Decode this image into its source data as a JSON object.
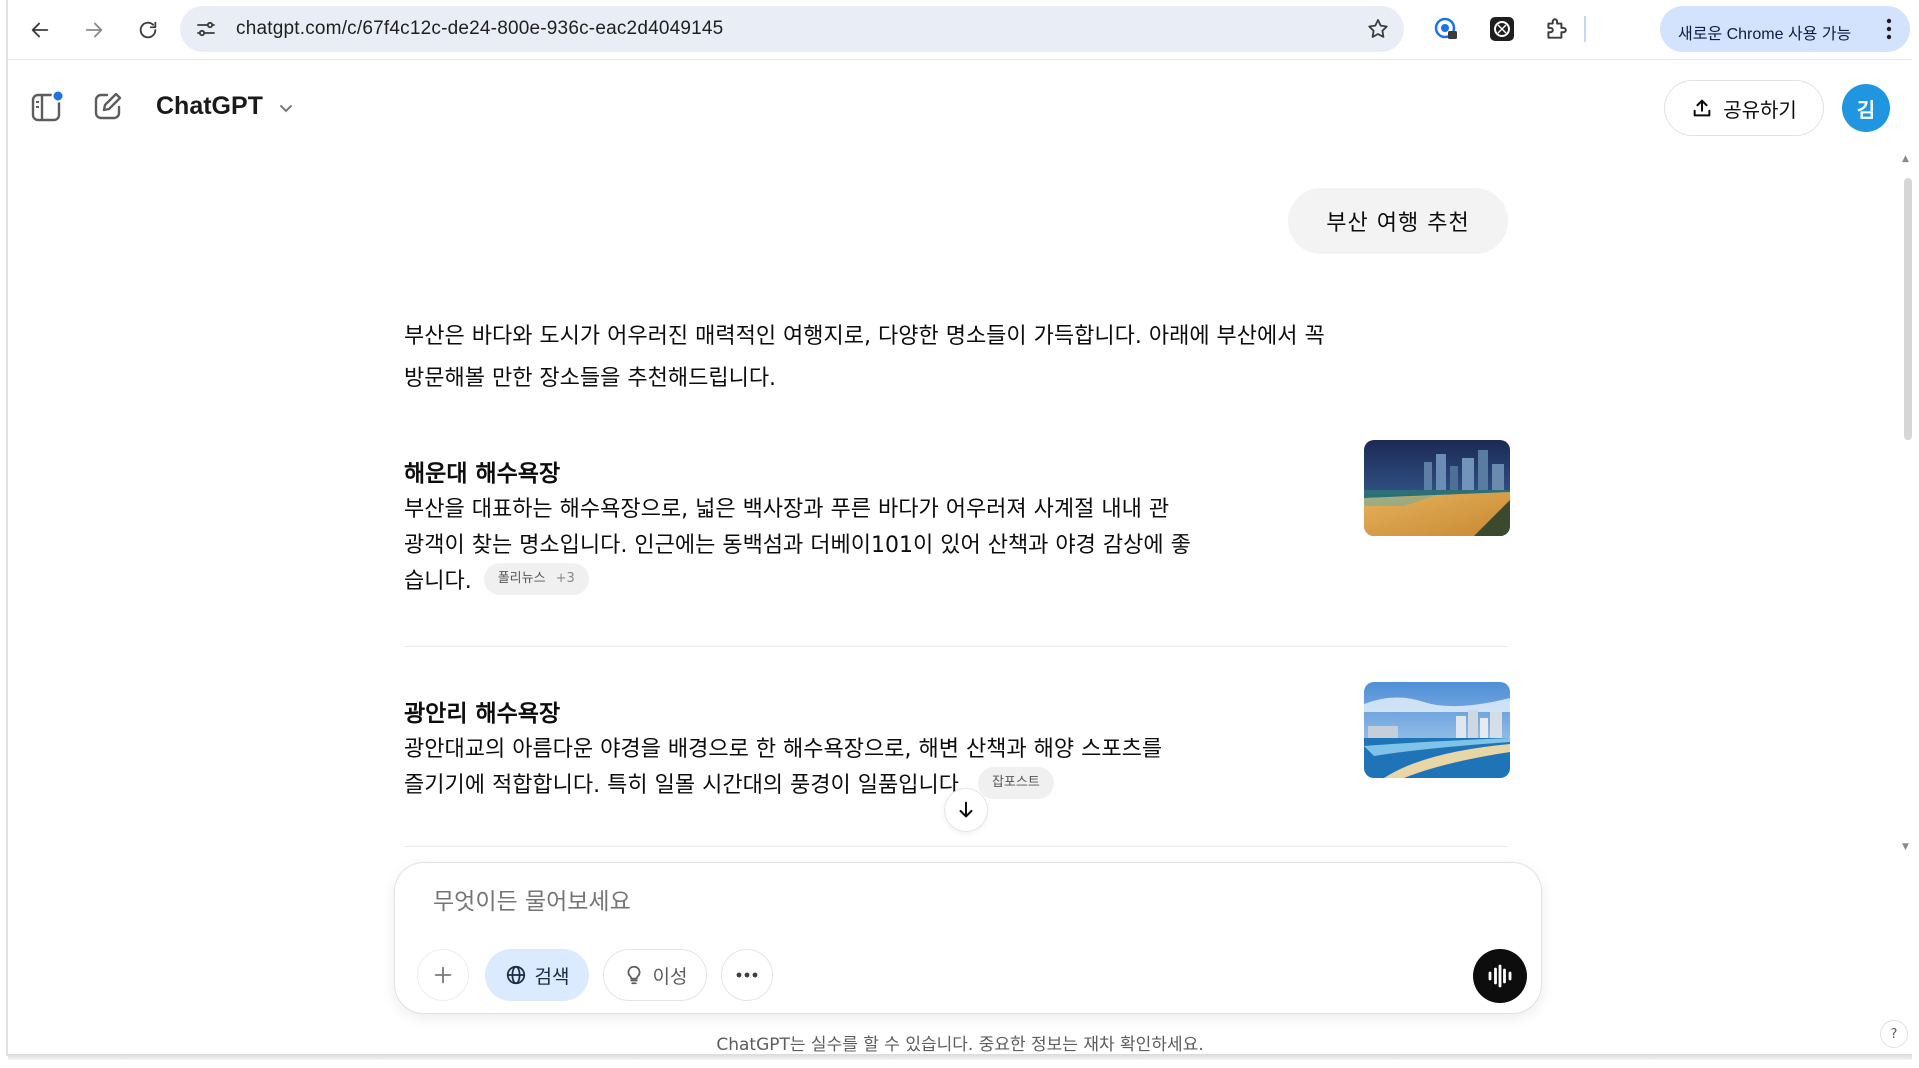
{
  "browser": {
    "url": "chatgpt.com/c/67f4c12c-de24-800e-936c-eac2d4049145",
    "update_label": "새로운 Chrome 사용 가능"
  },
  "header": {
    "title": "ChatGPT",
    "share_label": "공유하기",
    "avatar_initial": "김"
  },
  "chat": {
    "user_message": "부산 여행 추천",
    "intro_line1": "부산은 바다와 도시가 어우러진 매력적인 여행지로, 다양한 명소들이 가득합니다. 아래에 부산에서 꼭",
    "intro_line2": "방문해볼 만한 장소들을 추천해드립니다.",
    "places": [
      {
        "title": "해운대 해수욕장",
        "desc_line1": "부산을 대표하는 해수욕장으로, 넓은 백사장과 푸른 바다가 어우러져 사계절 내내 관",
        "desc_line2": "광객이 찾는 명소입니다. 인근에는 동백섬과 더베이101이 있어 산책과 야경 감상에 좋",
        "desc_line3": "습니다.",
        "source": "폴리뉴스",
        "source_more": "+3"
      },
      {
        "title": "광안리 해수욕장",
        "desc_line1": "광안대교의 아름다운 야경을 배경으로 한 해수욕장으로, 해변 산책과 해양 스포츠를",
        "desc_line2": "즐기기에 적합합니다. 특히 일몰 시간대의 풍경이 일품입니다.",
        "source": "잡포스트"
      }
    ]
  },
  "composer": {
    "placeholder": "무엇이든 물어보세요",
    "search_label": "검색",
    "reason_label": "이성"
  },
  "footer": {
    "disclaimer": "ChatGPT는 실수를 할 수 있습니다. 중요한 정보는 재차 확인하세요.",
    "help": "?"
  },
  "colors": {
    "accent_blue": "#2196e0",
    "search_chip_bg": "#dbeafe",
    "omnibox_bg": "#e9eef6"
  }
}
